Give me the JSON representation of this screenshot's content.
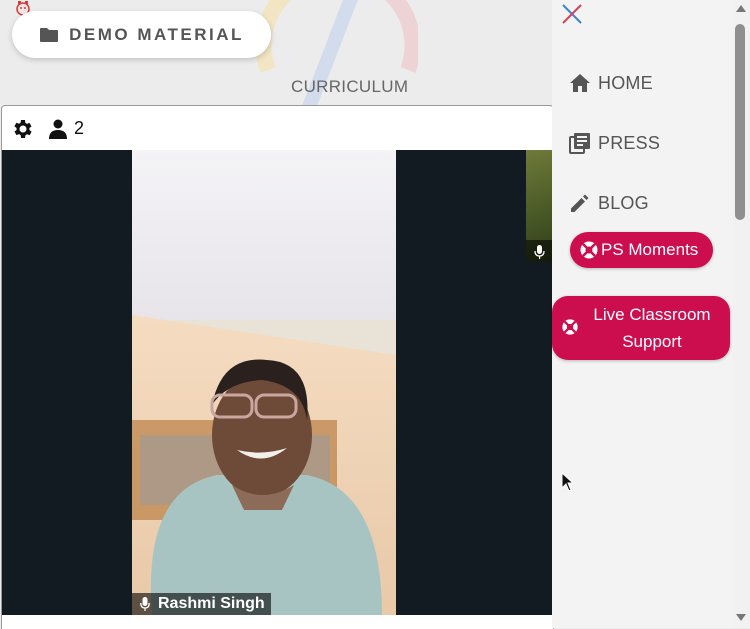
{
  "header": {
    "demo_button_label": "DEMO MATERIAL",
    "curriculum_label": "CURRICULUM"
  },
  "meeting": {
    "participant_count": "2",
    "main_participant_name": "Rashmi Singh"
  },
  "drawer": {
    "nav": [
      {
        "label": "HOME",
        "icon": "home-icon"
      },
      {
        "label": "PRESS",
        "icon": "press-icon"
      },
      {
        "label": "BLOG",
        "icon": "pencil-icon"
      }
    ],
    "ps_moments_label": "PS Moments",
    "live_support_line1": "Live Classroom",
    "live_support_line2": "Support"
  },
  "colors": {
    "accent": "#cc0e4f",
    "drawer_bg": "#f3f3f3",
    "stage_bg": "#121b22"
  }
}
